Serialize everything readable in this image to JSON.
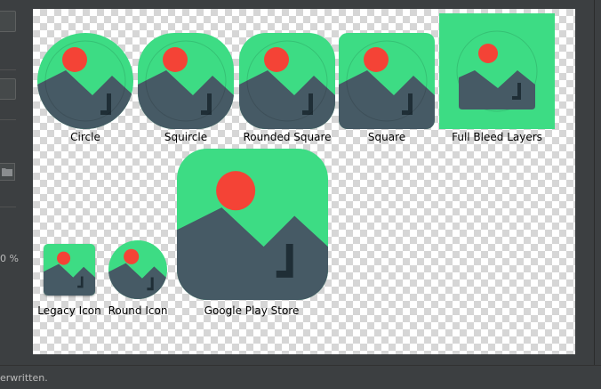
{
  "sidebar": {
    "percent_text": "0 %"
  },
  "preview": {
    "icons": [
      {
        "label": "Circle"
      },
      {
        "label": "Squircle"
      },
      {
        "label": "Rounded Square"
      },
      {
        "label": "Square"
      },
      {
        "label": "Full Bleed Layers"
      },
      {
        "label": "Legacy Icon"
      },
      {
        "label": "Round Icon"
      },
      {
        "label": "Google Play Store"
      }
    ]
  },
  "colors": {
    "sky": "#3ddc84",
    "mountain": "#465a65",
    "sun": "#f44336",
    "glyph": "#1f2e36"
  },
  "status": {
    "text": "erwritten."
  }
}
